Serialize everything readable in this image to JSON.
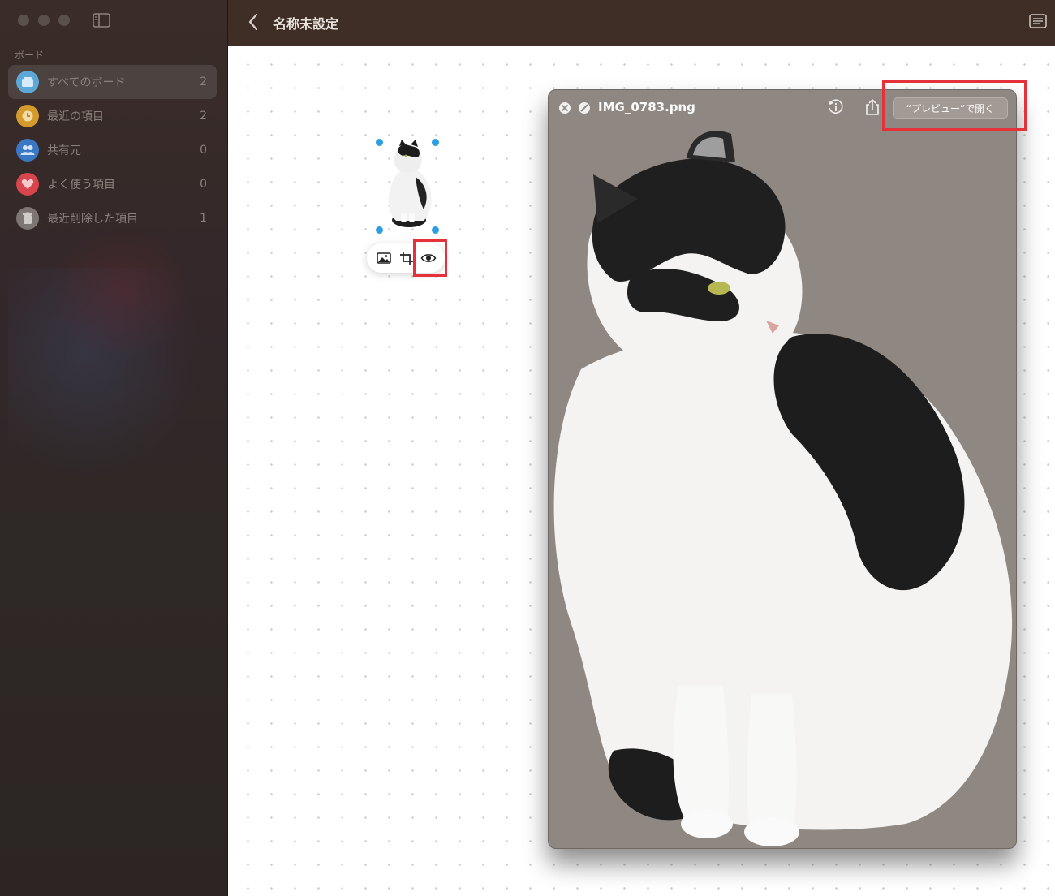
{
  "sidebar": {
    "section_label": "ボード",
    "items": [
      {
        "label": "すべてのボード",
        "count": "2",
        "icon": "boards-icon",
        "color": "#5ea8d8"
      },
      {
        "label": "最近の項目",
        "count": "2",
        "icon": "clock-icon",
        "color": "#d39a2d"
      },
      {
        "label": "共有元",
        "count": "0",
        "icon": "people-icon",
        "color": "#3a78c6"
      },
      {
        "label": "よく使う項目",
        "count": "0",
        "icon": "heart-icon",
        "color": "#d8454c"
      },
      {
        "label": "最近削除した項目",
        "count": "1",
        "icon": "trash-icon",
        "color": "#7d7672"
      }
    ]
  },
  "header": {
    "title": "名称未設定"
  },
  "quicklook": {
    "filename": "IMG_0783.png",
    "open_button": "“プレビュー”で開く"
  },
  "colors": {
    "highlight": "#e5323a",
    "selection": "#2c9fe3"
  }
}
